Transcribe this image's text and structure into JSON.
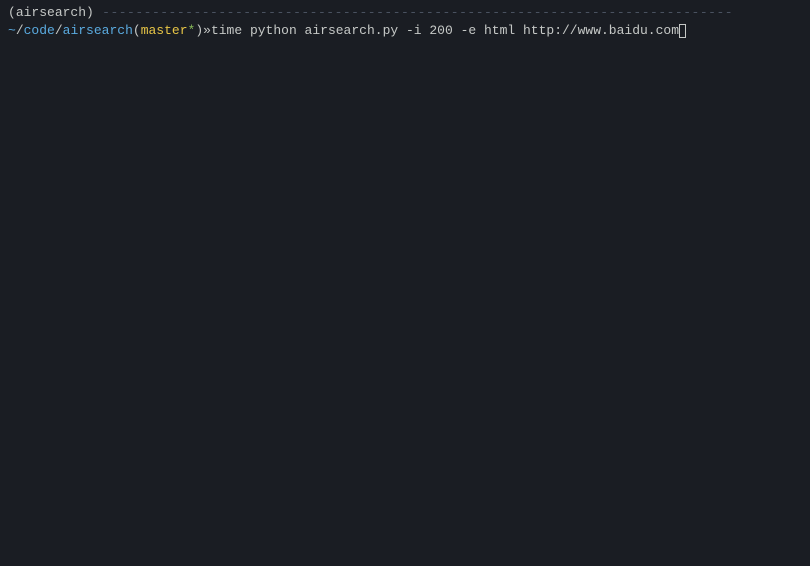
{
  "terminal": {
    "env_line": {
      "open_paren": "(",
      "env_name": "airsearch",
      "close_paren": ")",
      "dashes": " ----------------------------------------------------------------------------"
    },
    "prompt": {
      "tilde": "~",
      "slash1": "/",
      "code": "code",
      "slash2": "/",
      "airsearch": "airsearch",
      "open_paren": "(",
      "branch": "master",
      "star": "*",
      "close_paren": ")",
      "space1": " ",
      "arrow": "»",
      "space2": " ",
      "command": "time python airsearch.py -i 200 -e html http://www.baidu.com"
    }
  }
}
